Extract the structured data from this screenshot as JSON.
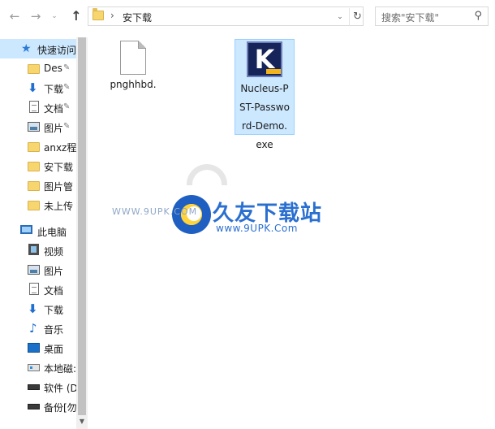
{
  "toolbar": {
    "back_glyph": "←",
    "forward_glyph": "→",
    "recent_glyph": "⌄",
    "up_glyph": "↑",
    "address_sep": "›",
    "address_text": "安下载",
    "dropdown_glyph": "⌄",
    "refresh_glyph": "↻"
  },
  "search": {
    "placeholder": "搜索\"安下载\"",
    "icon_glyph": "⚲"
  },
  "sidebar": {
    "items": [
      {
        "label": "快速访问",
        "icon": "star-icon",
        "pinned": false,
        "selected": true
      },
      {
        "label": "Des",
        "icon": "folder-icon",
        "pinned": true
      },
      {
        "label": "下载",
        "icon": "download-icon",
        "pinned": true
      },
      {
        "label": "文档",
        "icon": "document-icon",
        "pinned": true
      },
      {
        "label": "图片",
        "icon": "picture-icon",
        "pinned": true
      },
      {
        "label": "anxz程",
        "icon": "folder-icon",
        "pinned": false
      },
      {
        "label": "安下载",
        "icon": "folder-icon",
        "pinned": false
      },
      {
        "label": "图片管",
        "icon": "folder-icon",
        "pinned": false
      },
      {
        "label": "未上传",
        "icon": "folder-icon",
        "pinned": false
      },
      {
        "label": "此电脑",
        "icon": "computer-icon",
        "pinned": false
      },
      {
        "label": "视频",
        "icon": "video-icon",
        "pinned": false
      },
      {
        "label": "图片",
        "icon": "picture-icon",
        "pinned": false
      },
      {
        "label": "文档",
        "icon": "document-icon",
        "pinned": false
      },
      {
        "label": "下载",
        "icon": "download-icon",
        "pinned": false
      },
      {
        "label": "音乐",
        "icon": "music-icon",
        "pinned": false
      },
      {
        "label": "桌面",
        "icon": "desktop-icon",
        "pinned": false
      },
      {
        "label": "本地磁:",
        "icon": "drive-icon",
        "pinned": false
      },
      {
        "label": "软件 (D",
        "icon": "drive-icon",
        "pinned": false
      },
      {
        "label": "备份[勿",
        "icon": "drive-icon",
        "pinned": false
      }
    ],
    "pin_glyph": "✎",
    "star_glyph": "★",
    "download_glyph": "⬇",
    "music_glyph": "♪"
  },
  "scrollbar": {
    "down_glyph": "▼"
  },
  "files": [
    {
      "name": "pnghhbd.",
      "icon": "blank-file-icon",
      "selected": false
    },
    {
      "name_lines": [
        "Nucleus-P",
        "ST-Passwo",
        "rd-Demo.",
        "exe"
      ],
      "icon_letter": "K",
      "icon": "kernel-app-icon",
      "selected": true
    }
  ],
  "watermark": {
    "left_url": "WWW.9UPK.COM",
    "title": "久友下载站",
    "url": "www.9UPK.Com"
  },
  "colors": {
    "selection": "#cce8ff",
    "selection_border": "#99d1ff",
    "accent": "#2a6fd0"
  }
}
